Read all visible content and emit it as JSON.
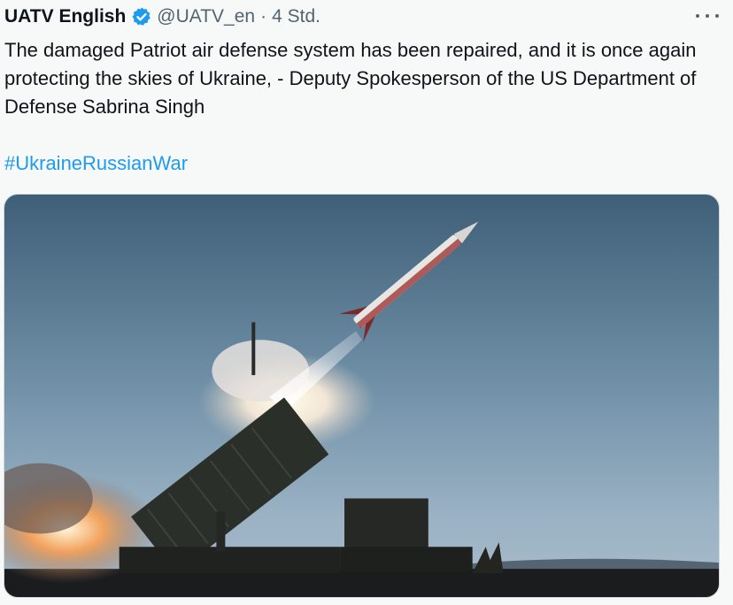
{
  "tweet": {
    "author_name": "UATV English",
    "handle": "@UATV_en",
    "separator": "·",
    "time": "4 Std.",
    "text": "The damaged Patriot air defense system has been repaired, and it is once again protecting the skies of Ukraine, - Deputy Spokesperson of the US Department of Defense Sabrina Singh",
    "hashtag": "#UkraineRussianWar"
  },
  "icons": {
    "verified": "verified-badge-icon",
    "more": "more-options-icon"
  },
  "colors": {
    "link": "#1d9bf0",
    "verified": "#1d9bf0",
    "secondary_text": "#536471",
    "background": "#f7f9f9"
  }
}
